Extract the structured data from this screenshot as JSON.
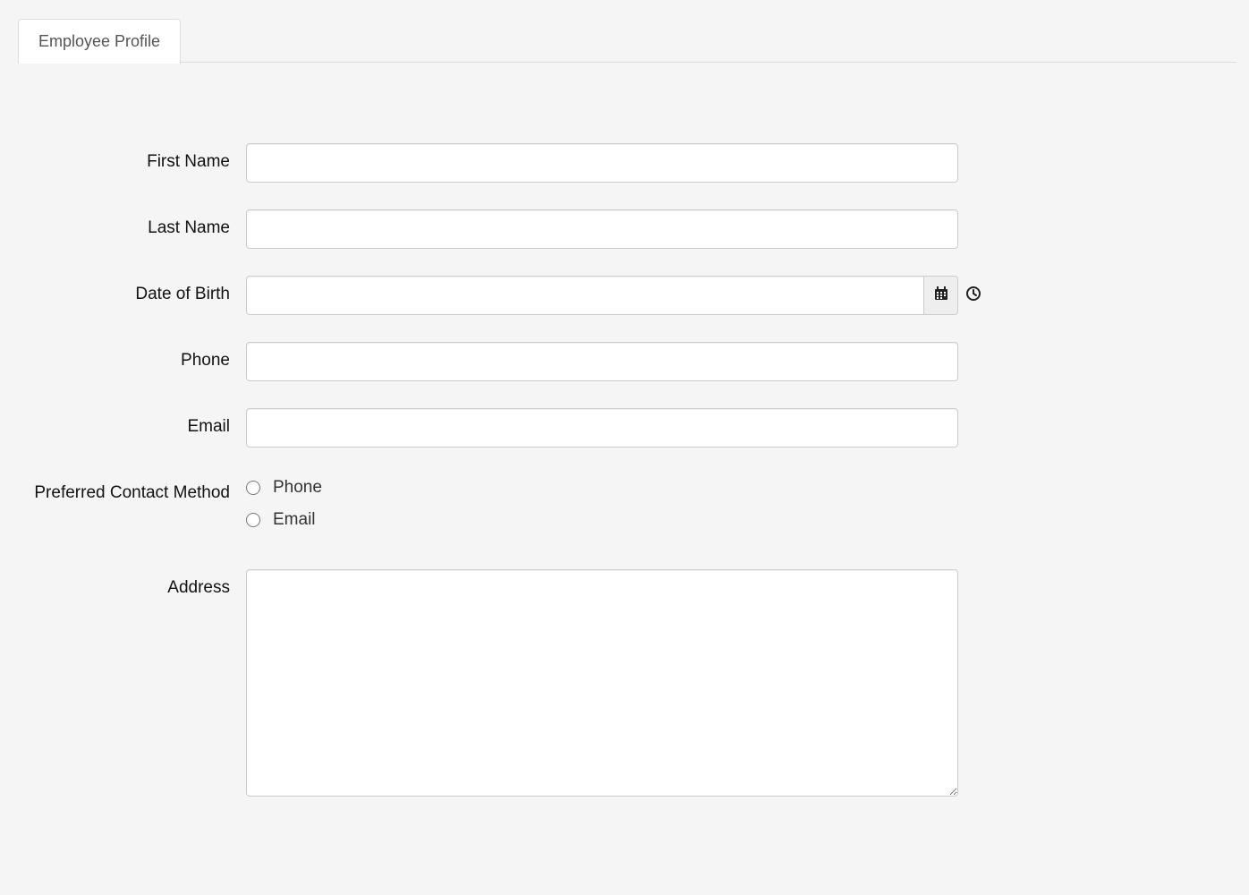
{
  "tabs": {
    "profile_label": "Employee Profile"
  },
  "form": {
    "first_name": {
      "label": "First Name",
      "value": ""
    },
    "last_name": {
      "label": "Last Name",
      "value": ""
    },
    "date_of_birth": {
      "label": "Date of Birth",
      "value": ""
    },
    "phone": {
      "label": "Phone",
      "value": ""
    },
    "email": {
      "label": "Email",
      "value": ""
    },
    "preferred_contact": {
      "label": "Preferred Contact Method",
      "options": {
        "phone": "Phone",
        "email": "Email"
      },
      "selected": ""
    },
    "address": {
      "label": "Address",
      "value": ""
    }
  }
}
